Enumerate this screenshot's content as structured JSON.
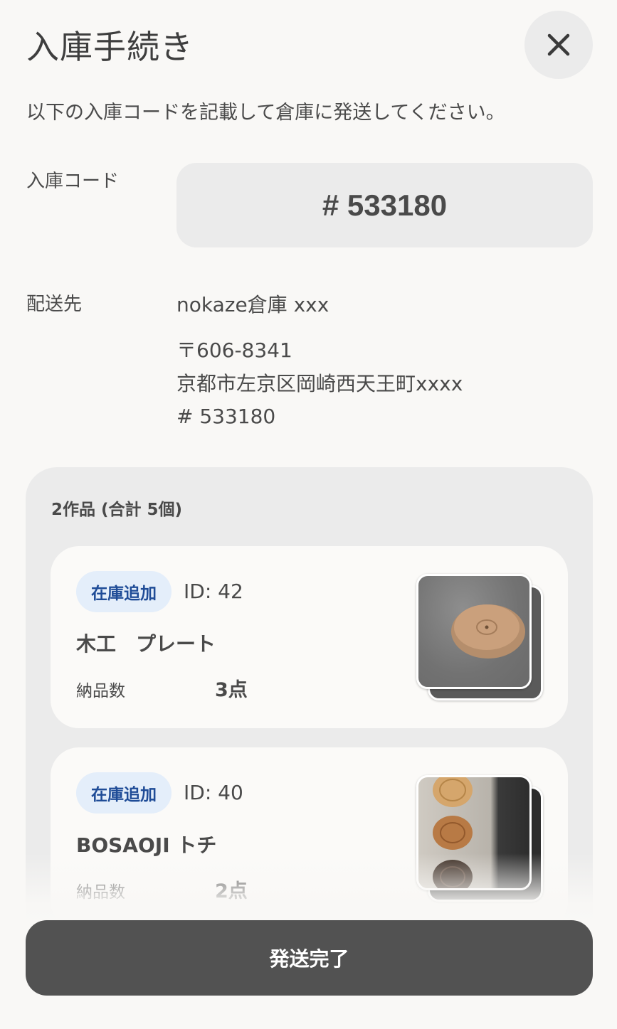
{
  "header": {
    "title": "入庫手続き",
    "close_icon": "close-icon"
  },
  "instruction": "以下の入庫コードを記載して倉庫に発送してください。",
  "code": {
    "label": "入庫コード",
    "value": "# 533180"
  },
  "destination": {
    "label": "配送先",
    "name": "nokaze倉庫 xxx",
    "postal": "〒606-8341",
    "address": "京都市左京区岡崎西天王町xxxx",
    "code": "# 533180"
  },
  "items_panel": {
    "summary": "2作品 (合計 5個)",
    "items": [
      {
        "badge": "在庫追加",
        "id": "ID: 42",
        "name": "木工　プレート",
        "qty_label": "納品数",
        "qty_value": "3点",
        "thumbnail": "wooden-plate-photo"
      },
      {
        "badge": "在庫追加",
        "id": "ID: 40",
        "name": "BOSAOJI トチ",
        "qty_label": "納品数",
        "qty_value": "2点",
        "thumbnail": "wooden-bowls-photo"
      }
    ]
  },
  "footer": {
    "submit_label": "発送完了"
  },
  "colors": {
    "background": "#f9f8f6",
    "panel": "#ebebeb",
    "badge_bg": "#e4eefa",
    "badge_text": "#1f4c97",
    "button": "#525252"
  }
}
